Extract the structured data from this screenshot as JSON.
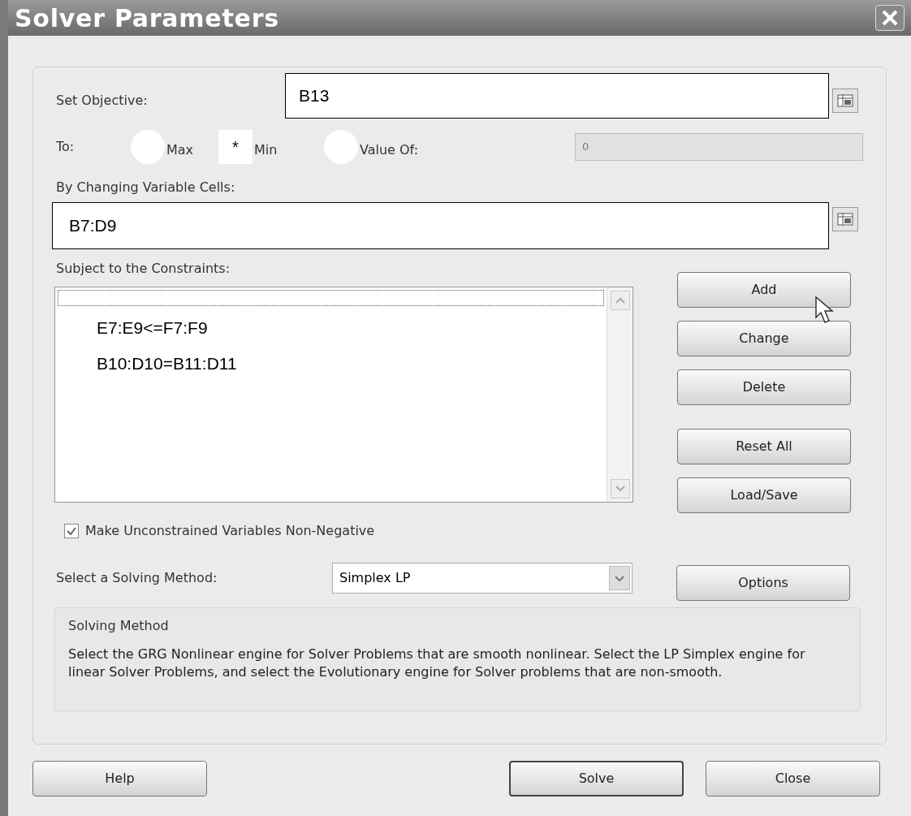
{
  "window": {
    "title": "Solver Parameters"
  },
  "objective": {
    "label": "Set Objective:",
    "value": "B13"
  },
  "to": {
    "label": "To:",
    "marker": "*",
    "options": [
      {
        "label": "Max",
        "selected": false
      },
      {
        "label": "Min",
        "selected": true
      },
      {
        "label": "Value Of:",
        "selected": false
      }
    ],
    "value_field": {
      "value": "0",
      "disabled": true
    }
  },
  "variables": {
    "label": "By Changing Variable Cells:",
    "value": "B7:D9"
  },
  "constraints": {
    "label": "Subject to the Constraints:",
    "items": [
      "E7:E9<=F7:F9",
      "B10:D10=B11:D11"
    ]
  },
  "side_buttons": [
    "Add",
    "Change",
    "Delete",
    "Reset All",
    "Load/Save"
  ],
  "non_negative": {
    "label": "Make Unconstrained Variables Non-Negative",
    "checked": true
  },
  "method": {
    "label": "Select a Solving Method:",
    "value": "Simplex LP",
    "button": "Options"
  },
  "method_box": {
    "title": "Solving Method",
    "text": "Select the GRG Nonlinear engine for Solver Problems that are smooth nonlinear. Select the LP Simplex engine for linear Solver Problems, and select the Evolutionary engine for Solver problems that are non-smooth."
  },
  "footer_buttons": [
    {
      "label": "Help",
      "default": false
    },
    {
      "label": "Solve",
      "default": true
    },
    {
      "label": "Close",
      "default": false
    }
  ]
}
